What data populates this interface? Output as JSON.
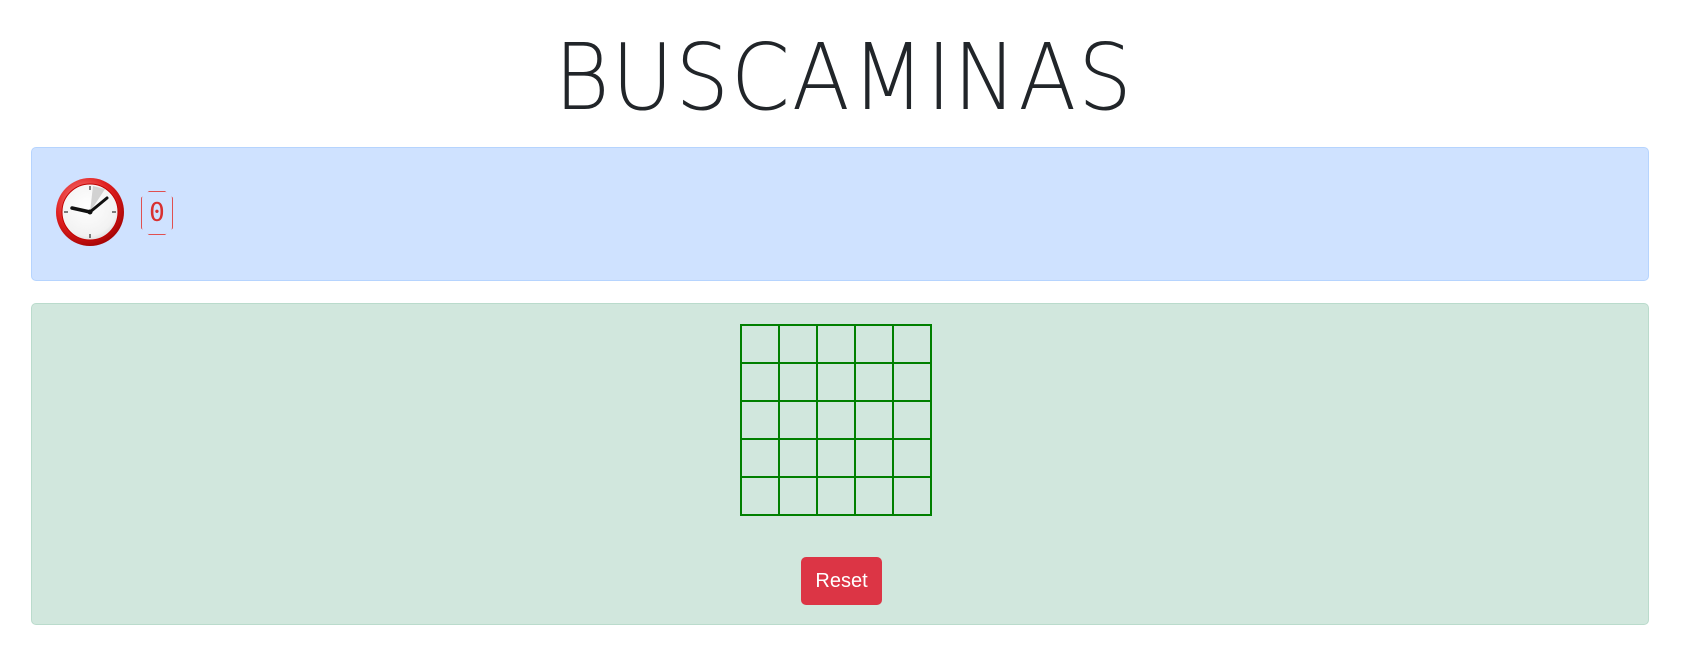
{
  "header": {
    "title": "BUSCAMINAS"
  },
  "status": {
    "clock_icon": "clock-icon",
    "counter_value": "0",
    "counter_color": "#d83030",
    "panel_color": "#cfe2ff"
  },
  "board": {
    "rows": 5,
    "cols": 5,
    "grid_color": "#008000",
    "panel_color": "#d1e7dd"
  },
  "actions": {
    "reset_label": "Reset",
    "reset_color": "#dc3545"
  }
}
